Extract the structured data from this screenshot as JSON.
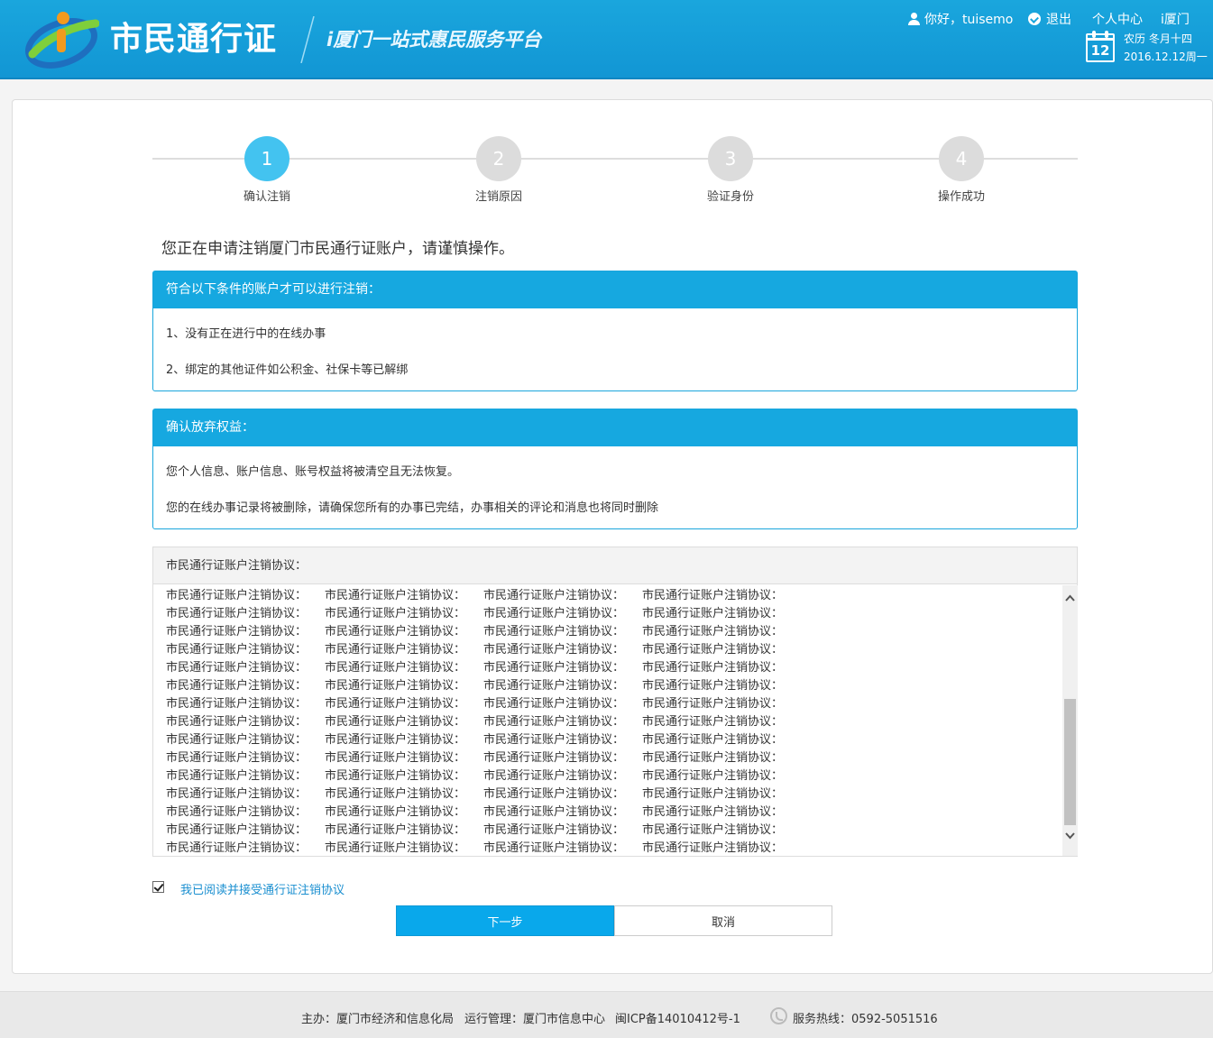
{
  "header": {
    "brand_title": "市民通行证",
    "brand_subtitle": "i厦门一站式惠民服务平台",
    "greeting": "你好，tuisemo",
    "logout_label": "退出",
    "personal_center_label": "个人中心",
    "ixiamen_label": "i厦门",
    "calendar_day": "12",
    "lunar_date": "农历  冬月十四",
    "date": "2016.12.12周一"
  },
  "steps": [
    {
      "number": "1",
      "label": "确认注销"
    },
    {
      "number": "2",
      "label": "注销原因"
    },
    {
      "number": "3",
      "label": "验证身份"
    },
    {
      "number": "4",
      "label": "操作成功"
    }
  ],
  "warning": "您正在申请注销厦门市民通行证账户，请谨慎操作。",
  "conditions": {
    "title": "符合以下条件的账户才可以进行注销：",
    "items": [
      "1、没有正在进行中的在线办事",
      "2、绑定的其他证件如公积金、社保卡等已解绑"
    ]
  },
  "rights": {
    "title": "确认放弃权益：",
    "items": [
      "您个人信息、账户信息、账号权益将被清空且无法恢复。",
      "您的在线办事记录将被删除，请确保您所有的办事已完结，办事相关的评论和消息也将同时删除"
    ]
  },
  "agreement": {
    "title": "市民通行证账户注销协议：",
    "repeat_text": "市民通行证账户注销协议：",
    "rows": 15,
    "columns": 4
  },
  "accept_label": "我已阅读并接受通行证注销协议",
  "buttons": {
    "next": "下一步",
    "cancel": "取消"
  },
  "footer": {
    "sponsor": "主办：厦门市经济和信息化局",
    "operator": "运行管理：厦门市信息中心",
    "icp": "闽ICP备14010412号-1",
    "hotline": "服务热线：0592-5051516"
  },
  "colors": {
    "primary": "#16a8e0",
    "step_active": "#43c3f0",
    "link": "#1a8fd0"
  }
}
